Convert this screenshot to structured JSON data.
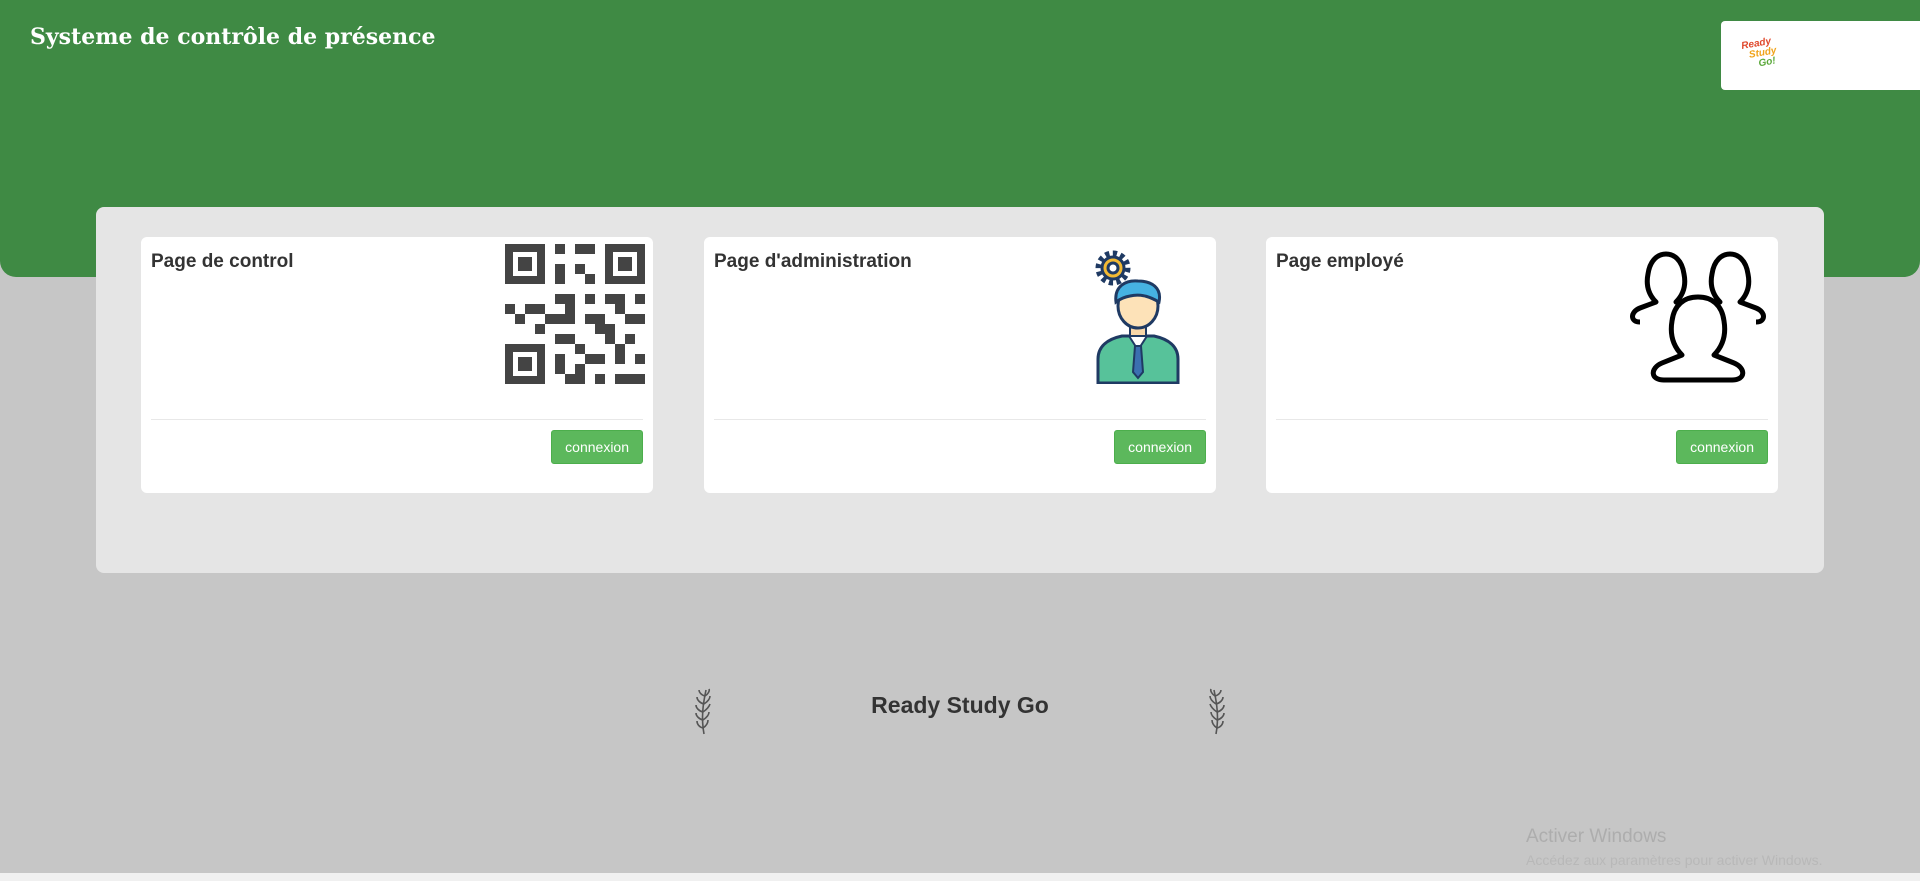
{
  "header": {
    "title": "Systeme de contrôle de présence",
    "logo": {
      "line1": "Ready",
      "line2": "Study",
      "line3": "Go!"
    }
  },
  "cards": [
    {
      "title": "Page de control",
      "icon": "qr-code-icon",
      "button": "connexion"
    },
    {
      "title": "Page d'administration",
      "icon": "admin-user-gear-icon",
      "button": "connexion"
    },
    {
      "title": "Page employé",
      "icon": "users-group-icon",
      "button": "connexion"
    }
  ],
  "footer": {
    "brand": "Ready Study Go"
  },
  "watermark": {
    "title": "Activer Windows",
    "subtitle": "Accédez aux paramètres pour activer Windows."
  },
  "colors": {
    "header": "#3f8a44",
    "button": "#5cb85c",
    "background": "#c6c6c6",
    "panel": "#e5e5e5"
  }
}
